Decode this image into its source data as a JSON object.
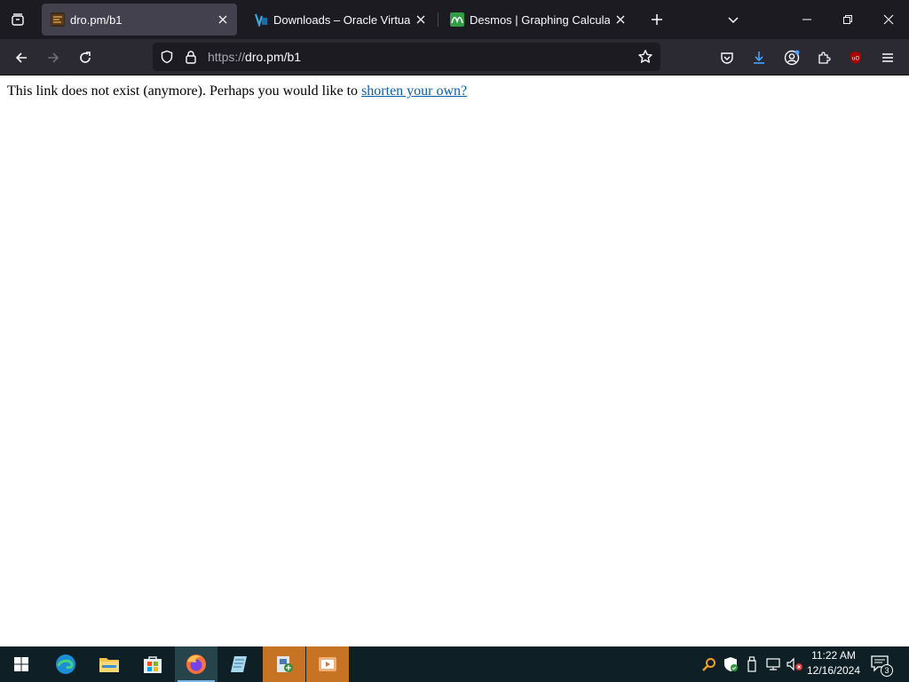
{
  "browser": {
    "tabs": [
      {
        "title": "dro.pm/b1",
        "active": true,
        "favicon": "dropm-favicon"
      },
      {
        "title": "Downloads – Oracle VirtualBox",
        "active": false,
        "favicon": "virtualbox-favicon"
      },
      {
        "title": "Desmos | Graphing Calculator",
        "active": false,
        "favicon": "desmos-favicon"
      }
    ],
    "url": {
      "scheme": "https://",
      "host_path": "dro.pm/b1"
    },
    "icons": {
      "tab_list": "tab-list-icon",
      "new_tab": "plus-icon",
      "list_all_tabs": "chevron-down-icon",
      "minimize": "minimize-icon",
      "restore": "restore-icon",
      "close_window": "close-icon",
      "back": "back-arrow-icon",
      "forward": "forward-arrow-icon",
      "reload": "reload-icon",
      "tracking_protection": "shield-icon",
      "site_security": "lock-icon",
      "bookmark": "star-icon",
      "pocket": "pocket-icon",
      "downloads": "download-icon",
      "account": "account-icon",
      "extensions": "puzzle-icon",
      "ublock": "ublock-icon",
      "menu": "hamburger-icon"
    },
    "accent_colors": {
      "tabstrip": "#1c1b22",
      "toolbar": "#2b2a33",
      "active_tab": "#42414d",
      "download_blue": "#45a1ff",
      "ublock_red": "#a00"
    }
  },
  "page": {
    "message_text": "This link does not exist (anymore). Perhaps you would like to ",
    "link_text": "shorten your own?",
    "link_color": "#0a5eab"
  },
  "taskbar": {
    "items": [
      {
        "name": "start-icon"
      },
      {
        "name": "edge-icon"
      },
      {
        "name": "file-explorer-icon"
      },
      {
        "name": "microsoft-store-icon"
      },
      {
        "name": "firefox-icon",
        "active": true
      },
      {
        "name": "notepad-icon"
      },
      {
        "name": "installer-icon",
        "highlight": true
      },
      {
        "name": "media-player-icon",
        "highlight": true
      }
    ],
    "tray": [
      "search-tool-icon",
      "defender-icon",
      "usb-icon",
      "network-icon",
      "volume-muted-icon"
    ],
    "clock": {
      "time": "11:22 AM",
      "date": "12/16/2024"
    },
    "notifications_count": "3"
  }
}
